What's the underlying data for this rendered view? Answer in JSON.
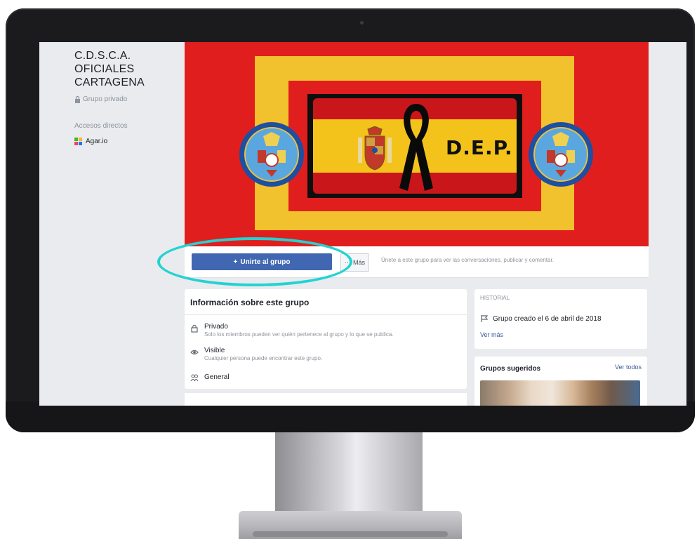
{
  "sidebar": {
    "group_name_line1": "C.D.S.C.A.",
    "group_name_line2": "OFICIALES",
    "group_name_line3": "CARTAGENA",
    "privacy": "Grupo privado",
    "shortcuts_title": "Accesos directos",
    "shortcut_item": "Agar.io"
  },
  "cover": {
    "overlay_text": "D.E.P."
  },
  "actions": {
    "join_label": "Unirte al grupo",
    "more_label": "Más",
    "hint": "Únete a este grupo para ver las conversaciones, publicar y comentar."
  },
  "about": {
    "title": "Información sobre este grupo",
    "private_label": "Privado",
    "private_desc": "Solo los miembros pueden ver quién pertenece al grupo y lo que se publica.",
    "visible_label": "Visible",
    "visible_desc": "Cualquier persona puede encontrar este grupo.",
    "general_label": "General"
  },
  "history": {
    "title": "HISTORIAL",
    "created": "Grupo creado el 6 de abril de 2018",
    "see_more": "Ver más"
  },
  "suggested": {
    "title": "Grupos sugeridos",
    "see_all": "Ver todos"
  },
  "colors": {
    "join_button": "#4267b2",
    "highlight": "#22d3d1",
    "cover_red": "#e11e1e",
    "cover_yellow": "#f2c12e"
  }
}
